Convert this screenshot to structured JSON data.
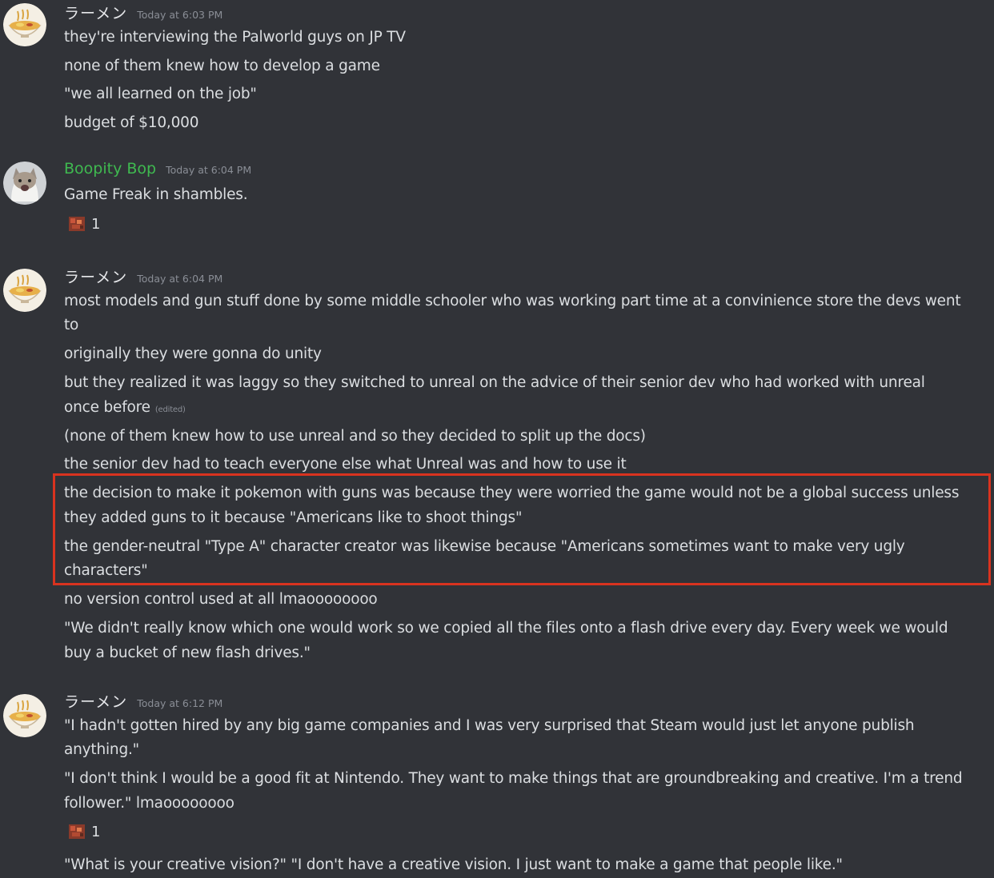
{
  "messages": [
    {
      "username": "ラーメン",
      "timestamp": "Today at 6:03 PM",
      "lines": [
        "they're interviewing the Palworld guys on JP TV",
        "none of them knew how to develop a game",
        "\"we all learned on the job\"",
        "budget of $10,000"
      ]
    },
    {
      "username": "Boopity Bop",
      "timestamp": "Today at 6:04 PM",
      "lines": [
        "Game Freak in shambles."
      ],
      "reaction_count": "1"
    },
    {
      "username": "ラーメン",
      "timestamp": "Today at 6:04 PM",
      "lines": [
        "most models and gun stuff done by some middle schooler who was working part time at a convinience store the devs went",
        "to",
        "originally they were gonna do unity",
        "but they realized it was laggy so they switched to unreal on the advice of their senior dev who had worked with unreal",
        "once before",
        "(none of them knew how to use unreal and so they decided to split up the docs)",
        "the senior dev had to teach everyone else what Unreal was and how to use it",
        "the decision to make it pokemon with guns was because they were worried the game would not be a global success unless",
        "they added guns to it because \"Americans like to shoot things\"",
        "the gender-neutral \"Type A\" character creator was likewise because \"Americans sometimes want to make very ugly",
        "characters\"",
        "no version control used at all lmaoooooooo",
        "\"We didn't really know which one would work so we copied all the files onto a flash drive every day. Every week we would",
        "buy a bucket of new flash drives.\""
      ],
      "edited_label": "(edited)"
    },
    {
      "username": "ラーメン",
      "timestamp": "Today at 6:12 PM",
      "lines": [
        "\"I hadn't gotten hired by any big game companies and I was very surprised that Steam would just let anyone publish",
        "anything.\"",
        "\"I don't think I would be a good fit at Nintendo. They want to make things that are groundbreaking and creative. I'm a trend",
        "follower.\" lmaoooooooo",
        "\"What is your creative vision?\" \"I don't have a creative vision. I just want to make a game that people like.\""
      ],
      "reaction_count": "1"
    }
  ],
  "colors": {
    "background": "#313338",
    "text": "#dbdee1",
    "timestamp": "#8a8e96",
    "boopity_name": "#3fb950",
    "highlight_border": "#d9331f"
  },
  "icons": {
    "ramen_avatar": "ramen-bowl-avatar",
    "cat_avatar": "cat-avatar",
    "reaction": "pixel-emoji-reaction"
  }
}
